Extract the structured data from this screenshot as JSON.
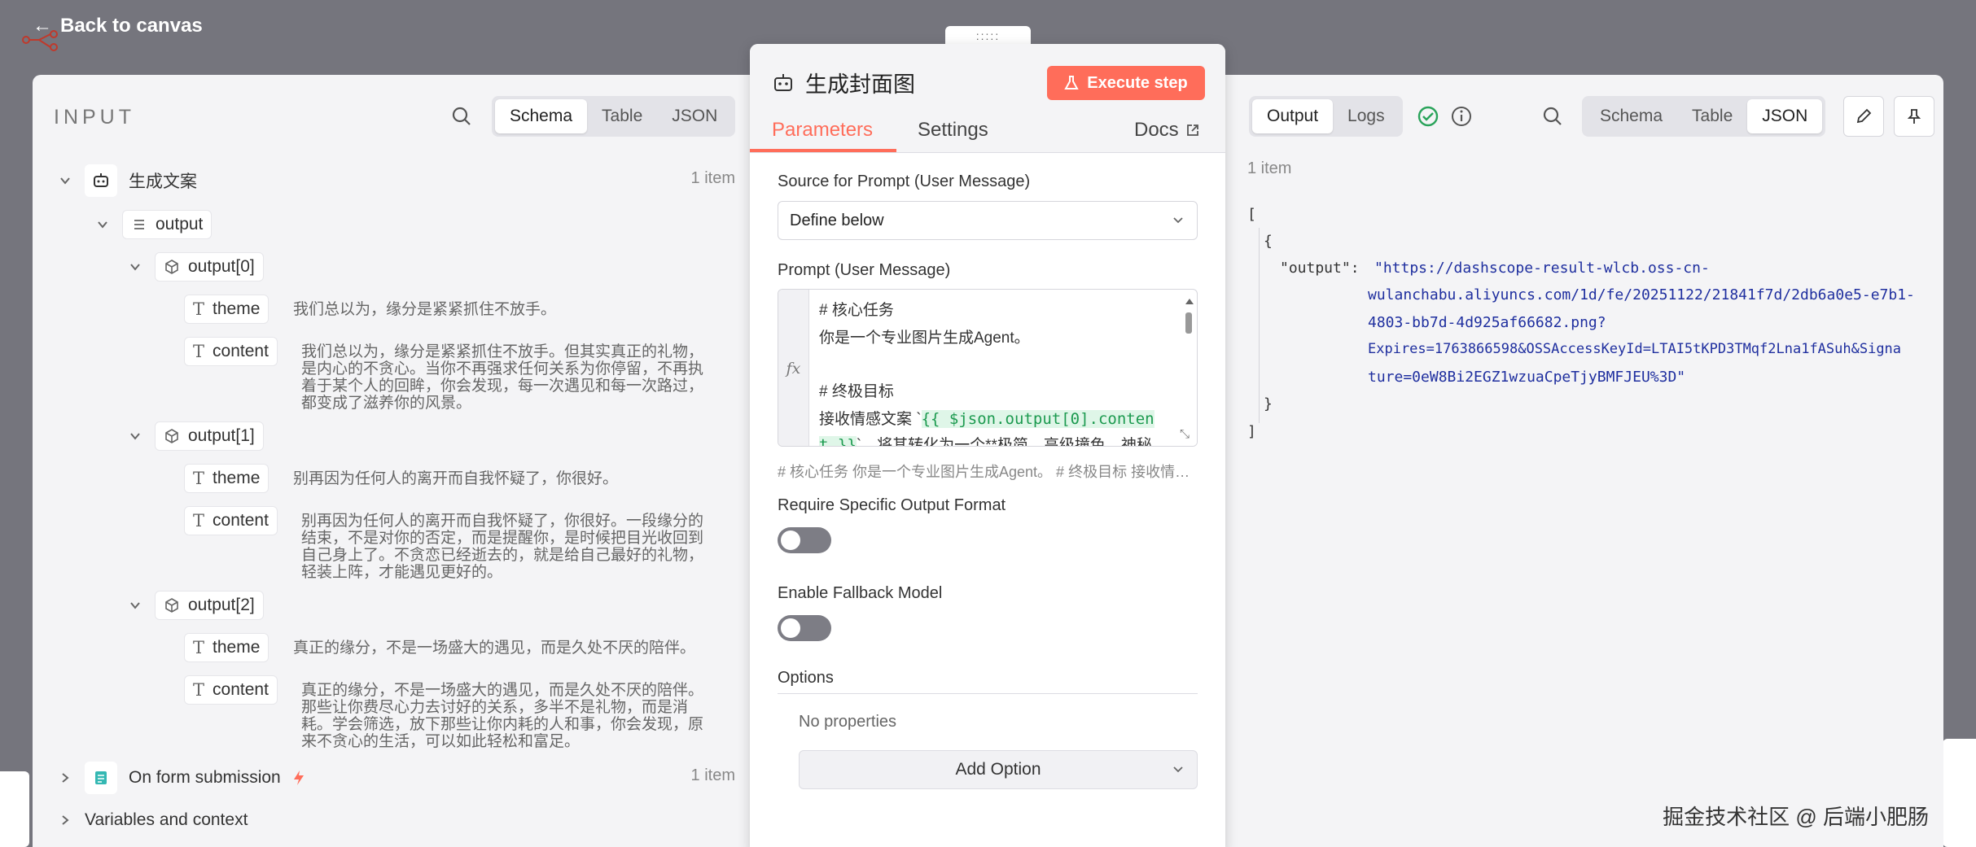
{
  "app": {
    "back_label": "Back to canvas",
    "watermark": "掘金技术社区 @ 后端小肥肠"
  },
  "input": {
    "title": "INPUT",
    "view_tabs": [
      "Schema",
      "Table",
      "JSON"
    ],
    "active_view": "Schema",
    "source_node": {
      "name": "生成文案",
      "count": "1 item"
    },
    "field": "output",
    "items": [
      {
        "label": "output[0]",
        "theme_key": "theme",
        "theme": "我们总以为，缘分是紧紧抓住不放手。",
        "content_key": "content",
        "content_lines": [
          "我们总以为，缘分是紧紧抓住不放手。但其实真正的礼物，",
          "是内心的不贪心。当你不再强求任何关系为你停留，不再执",
          "着于某个人的回眸，你会发现，每一次遇见和每一次路过，",
          "都变成了滋养你的风景。"
        ]
      },
      {
        "label": "output[1]",
        "theme_key": "theme",
        "theme": "别再因为任何人的离开而自我怀疑了，你很好。",
        "content_key": "content",
        "content_lines": [
          "别再因为任何人的离开而自我怀疑了，你很好。一段缘分的",
          "结束，不是对你的否定，而是提醒你，是时候把目光收回到",
          "自己身上了。不贪恋已经逝去的，就是给自己最好的礼物，",
          "轻装上阵，才能遇见更好的。"
        ]
      },
      {
        "label": "output[2]",
        "theme_key": "theme",
        "theme": "真正的缘分，不是一场盛大的遇见，而是久处不厌的陪伴。",
        "content_key": "content",
        "content_lines": [
          "真正的缘分，不是一场盛大的遇见，而是久处不厌的陪伴。",
          "那些让你费尽心力去讨好的关系，多半不是礼物，而是消",
          "耗。学会筛选，放下那些让你内耗的人和事，你会发现，原",
          "来不贪心的生活，可以如此轻松和富足。"
        ]
      }
    ],
    "form_node": {
      "name": "On form submission",
      "count": "1 item"
    },
    "variables_label": "Variables and context"
  },
  "node": {
    "title": "生成封面图",
    "execute_label": "Execute step",
    "tabs": {
      "parameters": "Parameters",
      "settings": "Settings",
      "docs": "Docs"
    },
    "source_label": "Source for Prompt (User Message)",
    "source_value": "Define below",
    "prompt_label": "Prompt (User Message)",
    "prompt_lines": {
      "l1": "# 核心任务",
      "l2": "你是一个专业图片生成Agent。",
      "l3": "# 终极目标",
      "l4_pre": "接收情感文案 `",
      "l4_expr": "{{ $json.output[0].conten",
      "l5_expr": "t }}",
      "l5_post": "`，将其转化为一个**极简、高级撞色、神秘"
    },
    "prompt_preview": "#  核心任务  你是一个专业图片生成Agent。  #  终极目标  接收情感文案",
    "require_format_label": "Require Specific Output Format",
    "require_format_on": false,
    "fallback_label": "Enable Fallback Model",
    "fallback_on": false,
    "options_label": "Options",
    "no_properties": "No properties",
    "add_option_label": "Add Option",
    "accent": "#ff6d5a"
  },
  "output": {
    "tabs": [
      "Output",
      "Logs"
    ],
    "active_tab": "Output",
    "view_tabs": [
      "Schema",
      "Table",
      "JSON"
    ],
    "active_view": "JSON",
    "count": "1 item",
    "json_lines": {
      "open_arr": "[",
      "open_obj": "{",
      "key": "\"output\":",
      "v1": "\"https://dashscope-result-wlcb.oss-cn-",
      "v2": "wulanchabu.aliyuncs.com/1d/fe/20251122/21841f7d/2db6a0e5-e7b1-",
      "v3": "4803-bb7d-4d925af66682.png?",
      "v4": "Expires=1763866598&OSSAccessKeyId=LTAI5tKPD3TMqf2Lna1fASuh&Signa",
      "v5": "ture=0eW8Bi2EGZ1wzuaCpeTjyBMFJEU%3D\"",
      "close_obj": "}",
      "close_arr": "]"
    }
  }
}
